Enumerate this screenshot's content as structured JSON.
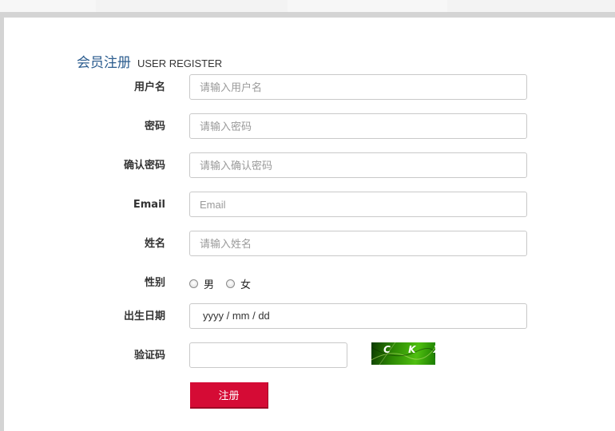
{
  "header": {
    "title_cn": "会员注册",
    "title_en": "USER REGISTER"
  },
  "form": {
    "username": {
      "label": "用户名",
      "placeholder": "请输入用户名"
    },
    "password": {
      "label": "密码",
      "placeholder": "请输入密码"
    },
    "confirm_password": {
      "label": "确认密码",
      "placeholder": "请输入确认密码"
    },
    "email": {
      "label": "Email",
      "placeholder": "Email"
    },
    "name": {
      "label": "姓名",
      "placeholder": "请输入姓名"
    },
    "gender": {
      "label": "性别",
      "options": [
        "男",
        "女"
      ]
    },
    "birthdate": {
      "label": "出生日期",
      "value": "yyyy / mm / dd"
    },
    "captcha": {
      "label": "验证码",
      "image_text": "Z C K X"
    },
    "submit_label": "注册"
  },
  "colors": {
    "heading": "#2c5d8f",
    "submit": "#d50b35",
    "captcha_bg": "#2e8a04"
  }
}
